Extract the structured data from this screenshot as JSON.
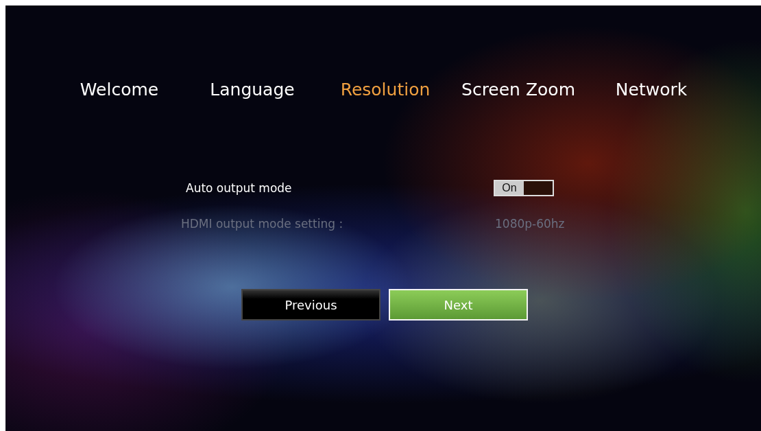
{
  "steps": [
    {
      "label": "Welcome",
      "selected": false
    },
    {
      "label": "Language",
      "selected": false
    },
    {
      "label": "Resolution",
      "selected": true
    },
    {
      "label": "Screen Zoom",
      "selected": false
    },
    {
      "label": "Network",
      "selected": false
    }
  ],
  "settings": [
    {
      "kind": "toggle",
      "label": "Auto output mode",
      "value": "On",
      "on": true,
      "disabled": false
    },
    {
      "kind": "value",
      "label": "HDMI output mode setting :",
      "value": "1080p-60hz",
      "disabled": true
    }
  ],
  "buttons": [
    {
      "label": "Previous",
      "focused": false
    },
    {
      "label": "Next",
      "focused": true
    }
  ]
}
